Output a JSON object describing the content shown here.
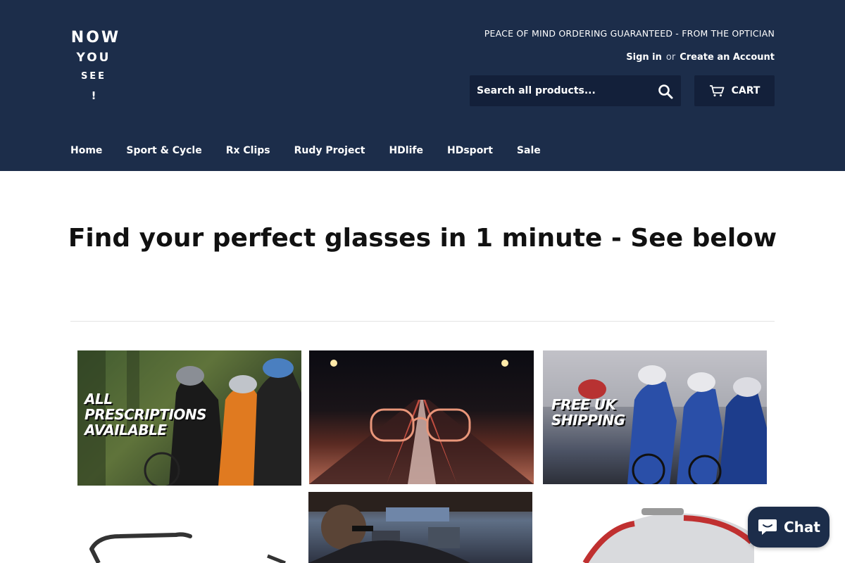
{
  "logo": {
    "line1": "NOW",
    "line2": "YOU",
    "line3": "SEE",
    "line4": "!"
  },
  "header": {
    "tagline": "PEACE OF MIND ORDERING GUARANTEED - FROM THE OPTICIAN",
    "sign_in": "Sign in",
    "or": "or",
    "create_account": "Create an Account"
  },
  "search": {
    "placeholder": "Search all products...",
    "icon": "search-icon"
  },
  "cart": {
    "label": "CART",
    "icon": "cart-icon"
  },
  "nav": {
    "items": [
      {
        "label": "Home"
      },
      {
        "label": "Sport & Cycle"
      },
      {
        "label": "Rx Clips"
      },
      {
        "label": "Rudy Project"
      },
      {
        "label": "HDlife"
      },
      {
        "label": "HDsport"
      },
      {
        "label": "Sale"
      }
    ]
  },
  "hero": {
    "title": "Find your perfect glasses in 1 minute - See below"
  },
  "tiles": [
    {
      "overlay": "ALL PRESCRIPTIONS AVAILABLE"
    },
    {
      "overlay": ""
    },
    {
      "overlay": "FREE UK SHIPPING"
    },
    {
      "overlay": ""
    },
    {
      "overlay": ""
    },
    {
      "overlay": ""
    }
  ],
  "chat": {
    "label": "Chat",
    "icon": "chat-icon"
  },
  "colors": {
    "header_bg": "#1c2d4a",
    "search_bg": "#13203a",
    "text": "#111111"
  }
}
